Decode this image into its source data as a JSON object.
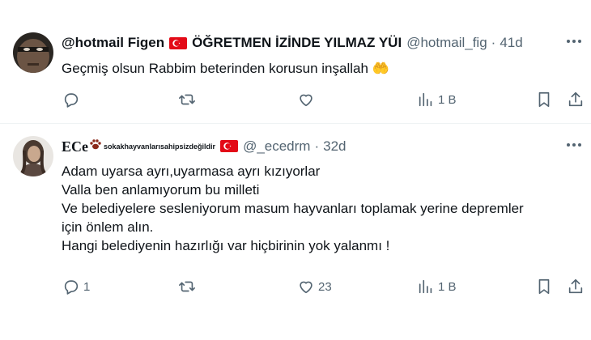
{
  "tweets": [
    {
      "display_name": "@hotmail Figen",
      "name_suffix": "ÖĞRETMEN İZİNDE YILMAZ YÜI",
      "handle": "@hotmail_fig",
      "dot": "·",
      "time": "41d",
      "text_lines": [
        "Geçmiş olsun Rabbim beterinden korusun inşallah 🤲"
      ],
      "actions": {
        "reply": "",
        "retweet": "",
        "like": "",
        "views": "1 B"
      }
    },
    {
      "display_name": "ECe",
      "name_suffix": "sokakhayvanlarısahipsizdeğildir",
      "handle": "@_ecedrm",
      "dot": "·",
      "time": "32d",
      "text_lines": [
        "Adam uyarsa ayrı,uyarmasa ayrı kızıyorlar",
        "Valla ben anlamıyorum bu milleti",
        "Ve belediyelere sesleniyorum masum hayvanları toplamak yerine depremler",
        "için önlem alın.",
        "Hangi belediyenin hazırlığı var hiçbirinin yok yalanmı !"
      ],
      "actions": {
        "reply": "1",
        "retweet": "",
        "like": "23",
        "views": "1 B"
      }
    }
  ],
  "icons": {
    "more": "more-horizontal-icon",
    "reply": "reply-icon",
    "retweet": "retweet-icon",
    "like": "heart-icon",
    "views": "views-icon",
    "bookmark": "bookmark-icon",
    "share": "share-icon",
    "flag": "turkey-flag-icon",
    "paw": "paw-icon"
  },
  "colors": {
    "text": "#0f1419",
    "secondary": "#536471",
    "divider": "#eff3f4",
    "flag": "#e30a17"
  }
}
